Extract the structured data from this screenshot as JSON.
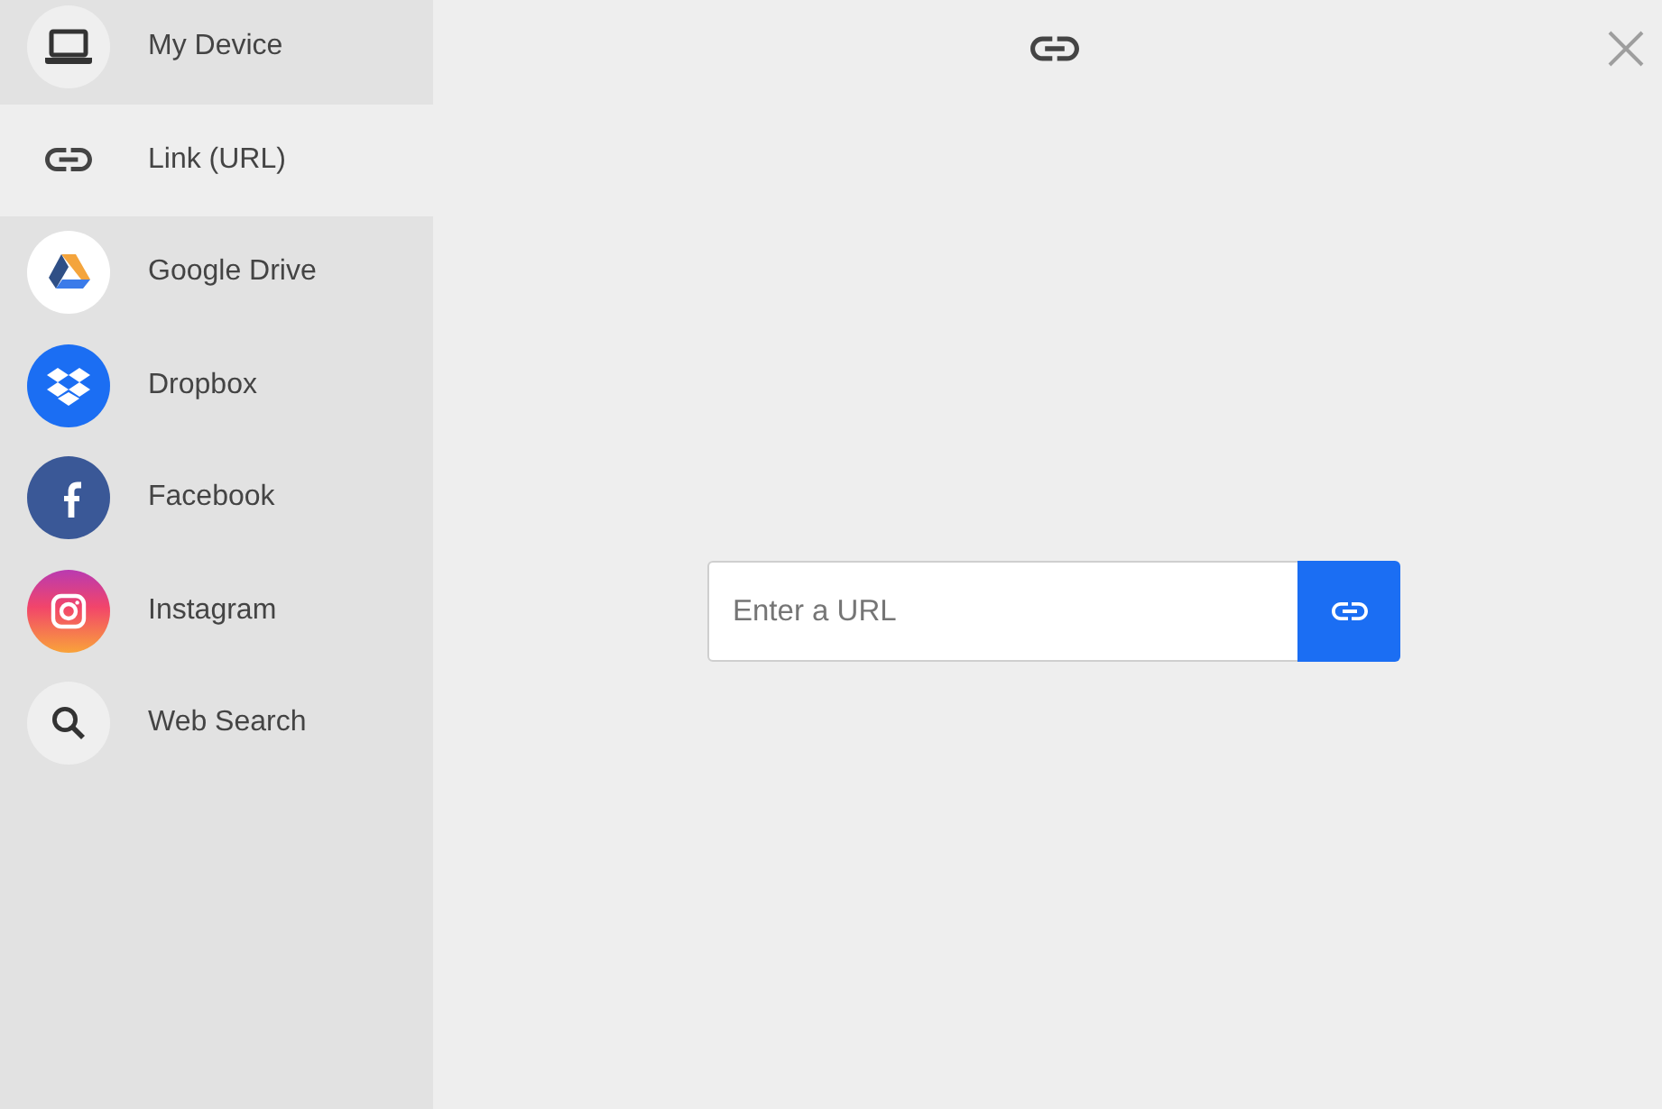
{
  "sidebar": {
    "items": [
      {
        "label": "My Device",
        "selected": false
      },
      {
        "label": "Link (URL)",
        "selected": true
      },
      {
        "label": "Google Drive",
        "selected": false
      },
      {
        "label": "Dropbox",
        "selected": false
      },
      {
        "label": "Facebook",
        "selected": false
      },
      {
        "label": "Instagram",
        "selected": false
      },
      {
        "label": "Web Search",
        "selected": false
      }
    ]
  },
  "url_form": {
    "placeholder": "Enter a URL"
  }
}
